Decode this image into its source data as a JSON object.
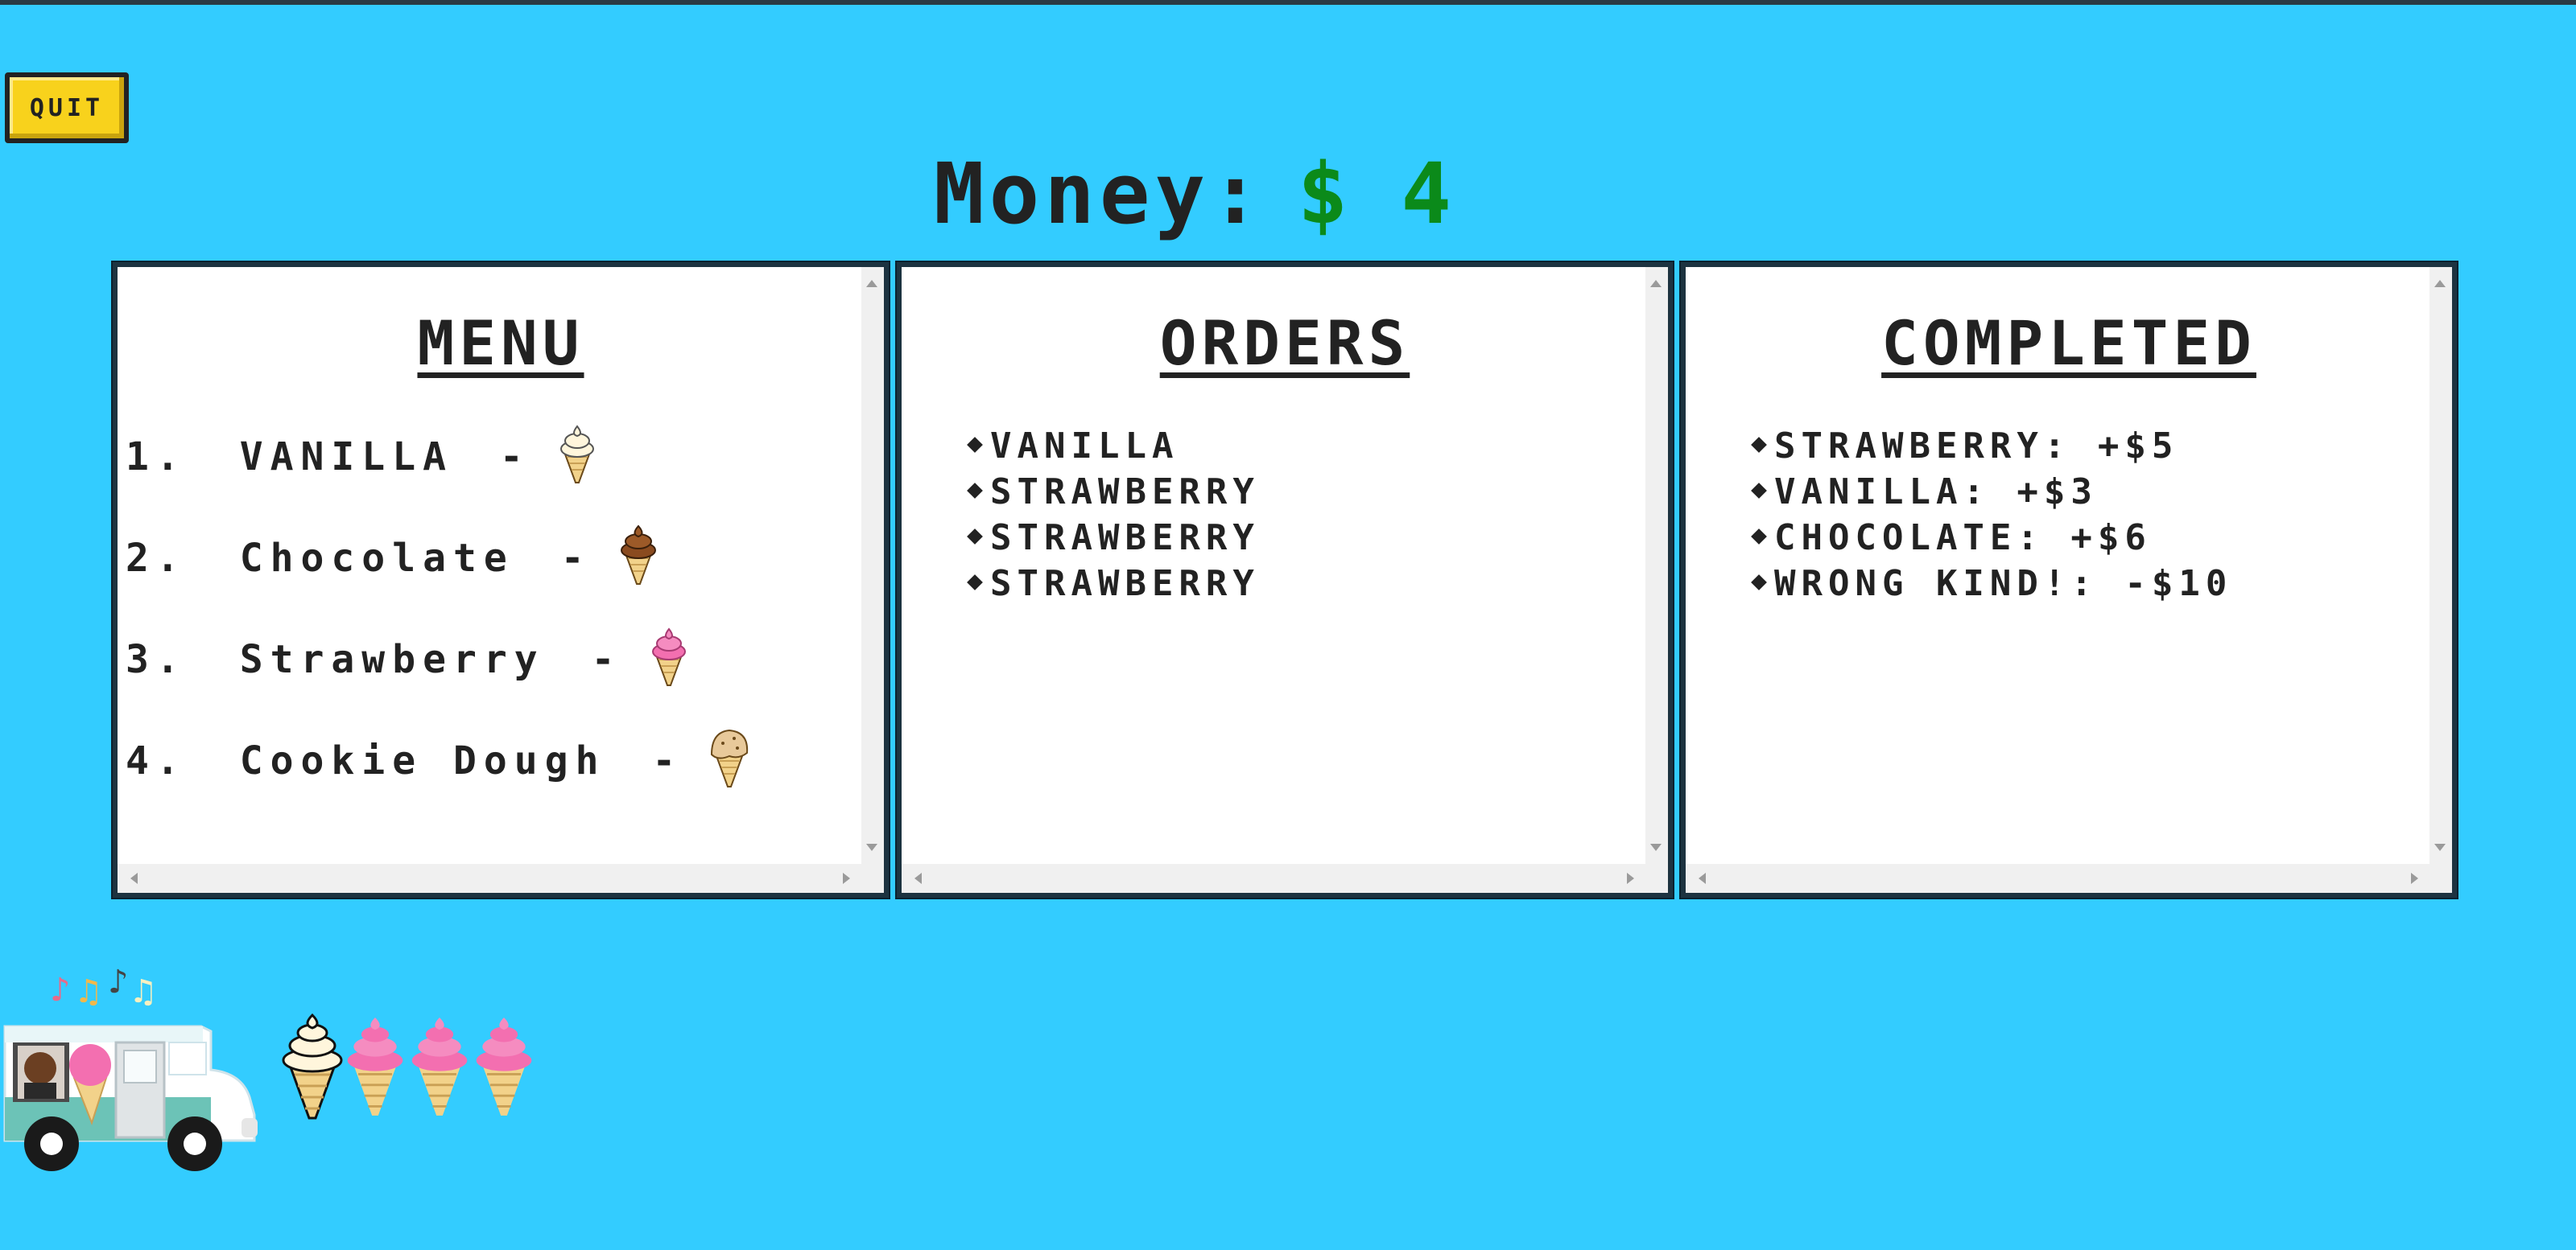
{
  "header": {
    "quit_label": "QUIT",
    "money_label": "Money:",
    "currency_symbol": "$",
    "money_value": "4"
  },
  "menu": {
    "title": "MENU",
    "items": [
      {
        "number": "1.",
        "name": "VANILLA",
        "dash": "-",
        "flavor_icon": "vanilla-cone-icon"
      },
      {
        "number": "2.",
        "name": "Chocolate",
        "dash": "-",
        "flavor_icon": "chocolate-cone-icon"
      },
      {
        "number": "3.",
        "name": "Strawberry",
        "dash": "-",
        "flavor_icon": "strawberry-cone-icon"
      },
      {
        "number": "4.",
        "name": "Cookie Dough",
        "dash": "-",
        "flavor_icon": "cookie-dough-cone-icon"
      }
    ]
  },
  "orders": {
    "title": "ORDERS",
    "items": [
      "VANILLA",
      "STRAWBERRY",
      "STRAWBERRY",
      "STRAWBERRY"
    ]
  },
  "completed": {
    "title": "COMPLETED",
    "items": [
      "STRAWBERRY: +$5",
      "VANILLA: +$3",
      "CHOCOLATE: +$6",
      "WRONG KIND!: -$10"
    ]
  },
  "queue": {
    "truck_icon": "ice-cream-truck-icon",
    "cones": [
      "vanilla",
      "strawberry",
      "strawberry",
      "strawberry"
    ]
  },
  "colors": {
    "background": "#33ccff",
    "quit_button": "#f8d21c",
    "money_value": "#0b8a1a",
    "vanilla": "#fff6dc",
    "chocolate": "#8a4b1f",
    "strawberry": "#f36fb0",
    "cookie_dough": "#e8c99a",
    "cone": "#f2d28a"
  }
}
